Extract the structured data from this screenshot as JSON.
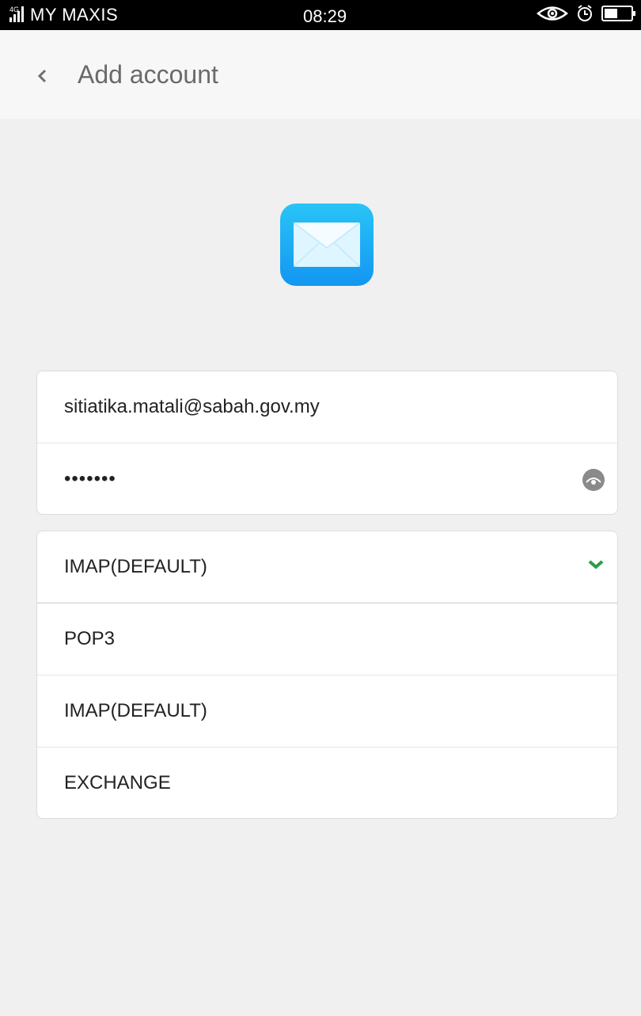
{
  "status_bar": {
    "network": "4G",
    "carrier": "MY MAXIS",
    "time": "08:29",
    "icons": [
      "signal-icon",
      "eye-comfort-icon",
      "alarm-icon",
      "battery-icon"
    ]
  },
  "header": {
    "back_icon": "chevron-left-icon",
    "title": "Add account"
  },
  "logo": {
    "icon": "mail-envelope-icon",
    "color": "#1ea7f5"
  },
  "login": {
    "email_value": "sitiatika.matali@sabah.gov.my",
    "password_mask": "•••••••",
    "password_toggle_icon": "eye-toggle-icon"
  },
  "protocol": {
    "selected": "IMAP(DEFAULT)",
    "selected_icon": "check-icon",
    "check_color": "#2e9b48",
    "options": [
      "POP3",
      "IMAP(DEFAULT)",
      "EXCHANGE"
    ]
  }
}
